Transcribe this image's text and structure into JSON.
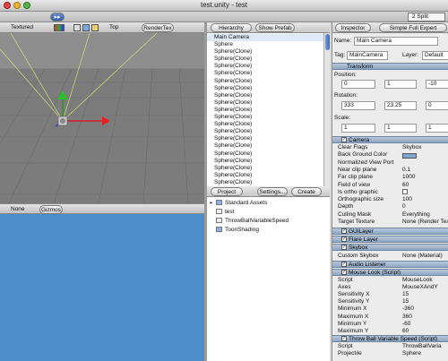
{
  "window": {
    "title": "test.unity - test",
    "split": "2 Split"
  },
  "scene": {
    "shading": "Textured",
    "view": "Top",
    "render": "RenderTex"
  },
  "game": {
    "aspect": "None",
    "gizmos": "Gizmos"
  },
  "hierarchy": {
    "tab": "Hierarchy",
    "show_prefab": "Show Prefab",
    "items": [
      "Main Camera",
      "Sphere",
      "Sphere(Clone)",
      "Sphere(Clone)",
      "Sphere(Clone)",
      "Sphere(Clone)",
      "Sphere(Clone)",
      "Sphere(Clone)",
      "Sphere(Clone)",
      "Sphere(Clone)",
      "Sphere(Clone)",
      "Sphere(Clone)",
      "Sphere(Clone)",
      "Sphere(Clone)",
      "Sphere(Clone)",
      "Sphere(Clone)",
      "Sphere(Clone)",
      "Sphere(Clone)",
      "Sphere(Clone)",
      "Sphere(Clone)",
      "Sphere(Clone)"
    ]
  },
  "project": {
    "tab": "Project",
    "settings": "Settings...",
    "create": "Create",
    "items": [
      "Standard Assets",
      "test",
      "ThrowBallVariableSpeed",
      "ToonShading"
    ]
  },
  "inspector": {
    "tab": "Inspector",
    "mode": "Simple Full Expert",
    "name_label": "Name:",
    "name_value": "Main Camera",
    "tag_label": "Tag:",
    "tag_value": "MainCamera",
    "layer_label": "Layer:",
    "layer_value": "Default",
    "transform": "Transform",
    "position_label": "Position:",
    "position": [
      "0",
      "1",
      "-10"
    ],
    "rotation_label": "Rotation:",
    "rotation": [
      "333",
      "23.25",
      "0"
    ],
    "scale_label": "Scale:",
    "scale": [
      "1",
      "1",
      "1"
    ],
    "camera": "Camera",
    "camera_props": [
      {
        "k": "Clear Flags",
        "v": "Skybox"
      },
      {
        "k": "Back Ground Color",
        "v": ""
      },
      {
        "k": "Normalized View Port",
        "v": ""
      },
      {
        "k": "Near clip plane",
        "v": "0.1"
      },
      {
        "k": "Far clip plane",
        "v": "1000"
      },
      {
        "k": "Field of view",
        "v": "60"
      },
      {
        "k": "Is ortho graphic",
        "v": ""
      },
      {
        "k": "Orthographic size",
        "v": "100"
      },
      {
        "k": "Depth",
        "v": "0"
      },
      {
        "k": "Culling Mask",
        "v": "Everything"
      },
      {
        "k": "Target Texture",
        "v": "None (Render Tex"
      }
    ],
    "guilayer": "GUILayer",
    "flarelayer": "Flare Layer",
    "skybox": "Skybox",
    "custom_skybox": {
      "k": "Custom Skybox",
      "v": "None (Material)"
    },
    "audio": "Audio Listener",
    "mouselook": "Mouse Look (Script)",
    "mouselook_props": [
      {
        "k": "Script",
        "v": "MouseLook"
      },
      {
        "k": "Axes",
        "v": "MouseXAndY"
      },
      {
        "k": "Sensitivity X",
        "v": "15"
      },
      {
        "k": "Sensitivity Y",
        "v": "15"
      },
      {
        "k": "Minimum X",
        "v": "-360"
      },
      {
        "k": "Maximum X",
        "v": "360"
      },
      {
        "k": "Minimum Y",
        "v": "-60"
      },
      {
        "k": "Maximum Y",
        "v": "60"
      }
    ],
    "throwball": "Throw Ball Variable Speed (Script)",
    "throwball_props": [
      {
        "k": "Script",
        "v": "ThrowBallVaria"
      },
      {
        "k": "Projectile",
        "v": "Sphere"
      }
    ],
    "colors": {
      "header": "#8ea6c2",
      "bg_color_swatch": "#7fa8d0"
    }
  }
}
